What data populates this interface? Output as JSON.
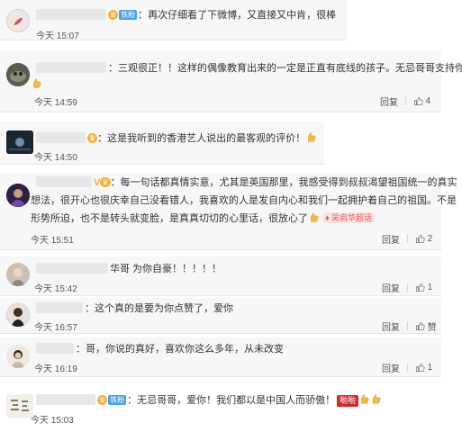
{
  "comments": [
    {
      "badge": "铁粉",
      "text": "：再次仔细看了下微博，又直接又中肯，很棒",
      "time": "今天 15:07"
    },
    {
      "text": "：三观很正！！这样的偶像教育出来的一定是正直有底线的孩子。无忌哥哥支持你",
      "time": "今天 14:59",
      "reply": "回复",
      "likes": "4"
    },
    {
      "text": "：这是我听到的香港艺人说出的最客观的评价！",
      "time": "今天 14:50"
    },
    {
      "v": "V",
      "text_lines": [
        "：每一句话都真情实意，尤其是英国那里，我感受得到叔叔渴望祖国统一的真实",
        "想法，很开心也很庆幸自己没看错人，我喜欢的人是发自内心和我们一起拥护着自己的祖国。不是",
        "形势所迫，也不是转头就变脸，是真真切切的心里话，很放心了"
      ],
      "tag": "吴启华超话",
      "time": "今天 15:51",
      "reply": "回复",
      "likes": "2"
    },
    {
      "text": "华哥 为你自豪！！！！！",
      "time": "今天 15:42",
      "reply": "回复",
      "likes": "1"
    },
    {
      "text": "：这个真的是要为你点赞了，爱你",
      "time": "今天 16:57",
      "reply": "回复",
      "likes": "赞"
    },
    {
      "text": "：哥，你说的真好，喜欢你这么多年，从未改变",
      "time": "今天 16:19",
      "reply": "回复",
      "likes": "1"
    },
    {
      "badge": "铁粉",
      "text": "：无忌哥哥，爱你！我们都以是中国人而骄傲！",
      "redtag": "喲喲",
      "time": "今天 15:03"
    }
  ],
  "colors": {
    "link": "#eb7350",
    "badge": "#49a0e6",
    "card": "#f7f7f7"
  },
  "icons": [
    "thumbs-up-icon",
    "clap-hand-emoji",
    "like-hand-emoji"
  ]
}
